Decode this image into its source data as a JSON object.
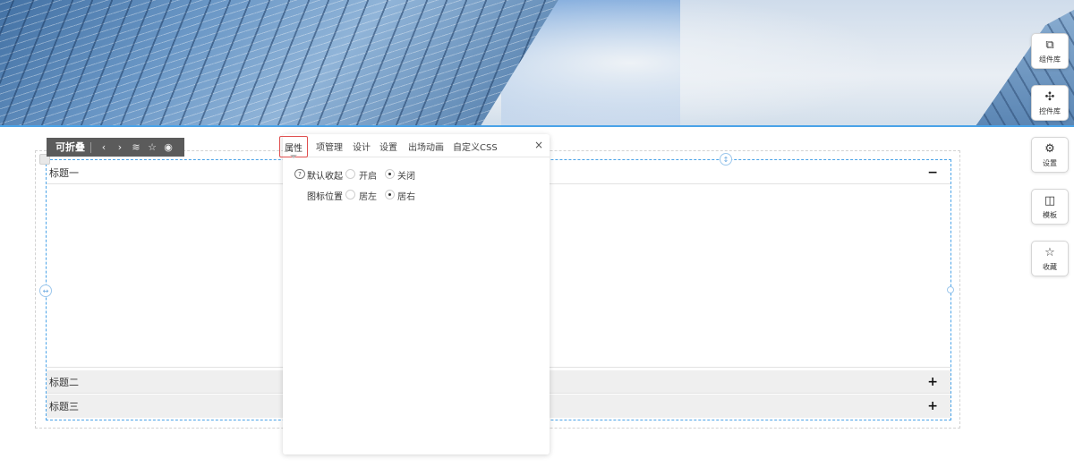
{
  "toolbar": {
    "name": "可折叠",
    "icons": {
      "prev": "‹",
      "next": "›",
      "layers": "≋",
      "star": "☆",
      "eye": "◉"
    }
  },
  "property_panel": {
    "tabs": [
      {
        "label": "属性",
        "active": true
      },
      {
        "label": "项管理"
      },
      {
        "label": "设计"
      },
      {
        "label": "设置"
      },
      {
        "label": "出场动画"
      },
      {
        "label": "自定义CSS"
      }
    ],
    "close_icon": "×",
    "help_icon": "?",
    "fields": {
      "default_collapse": {
        "label": "默认收起",
        "options": [
          {
            "label": "开启",
            "selected": false
          },
          {
            "label": "关闭",
            "selected": true
          }
        ]
      },
      "icon_position": {
        "label": "图标位置",
        "options": [
          {
            "label": "居左",
            "selected": false
          },
          {
            "label": "居右",
            "selected": true
          }
        ]
      }
    }
  },
  "collapse": {
    "items": [
      {
        "title": "标题一",
        "sign": "−",
        "expanded": true
      },
      {
        "title": "标题二",
        "sign": "+",
        "expanded": false
      },
      {
        "title": "标题三",
        "sign": "+",
        "expanded": false
      }
    ]
  },
  "handles": {
    "left": "↔",
    "top": "↕"
  },
  "sidebar": {
    "items": [
      {
        "label": "组件库",
        "icon": "⧉"
      },
      {
        "label": "控件库",
        "icon": "✣"
      },
      {
        "label": "设置",
        "icon": "⚙"
      },
      {
        "label": "模板",
        "icon": "◫"
      },
      {
        "label": "收藏",
        "icon": "☆"
      }
    ]
  },
  "colors": {
    "accent": "#4aa3e8",
    "active_tab_border": "#e05050",
    "toolbar_bg": "#5b5b5b"
  }
}
